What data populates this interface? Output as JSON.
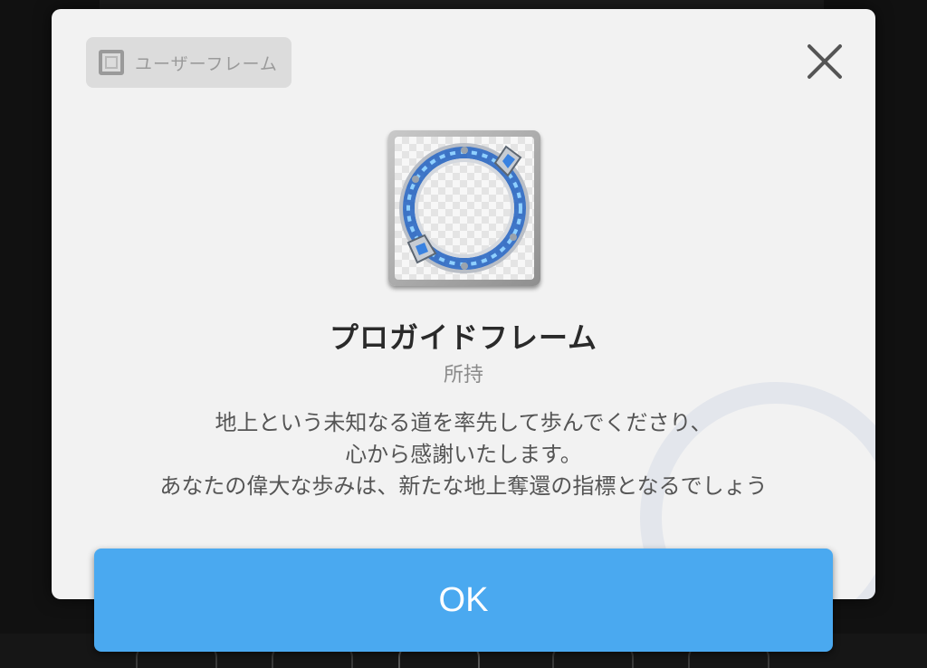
{
  "dialog": {
    "category_label": "ユーザーフレーム",
    "category_icon": "frame-icon",
    "close_icon": "close-icon",
    "item_icon": "frame-thumbnail",
    "item_name": "プロガイドフレーム",
    "owned_status": "所持",
    "description_lines": [
      "地上という未知なる道を率先して歩んでくださり、",
      "心から感謝いたします。",
      "あなたの偉大な歩みは、新たな地上奪還の指標となるでしょう"
    ],
    "ok_label": "OK"
  },
  "colors": {
    "ok_button": "#4aa9f0",
    "modal_bg": "#f2f2f2",
    "frame_accent": "#2f7bdc"
  }
}
